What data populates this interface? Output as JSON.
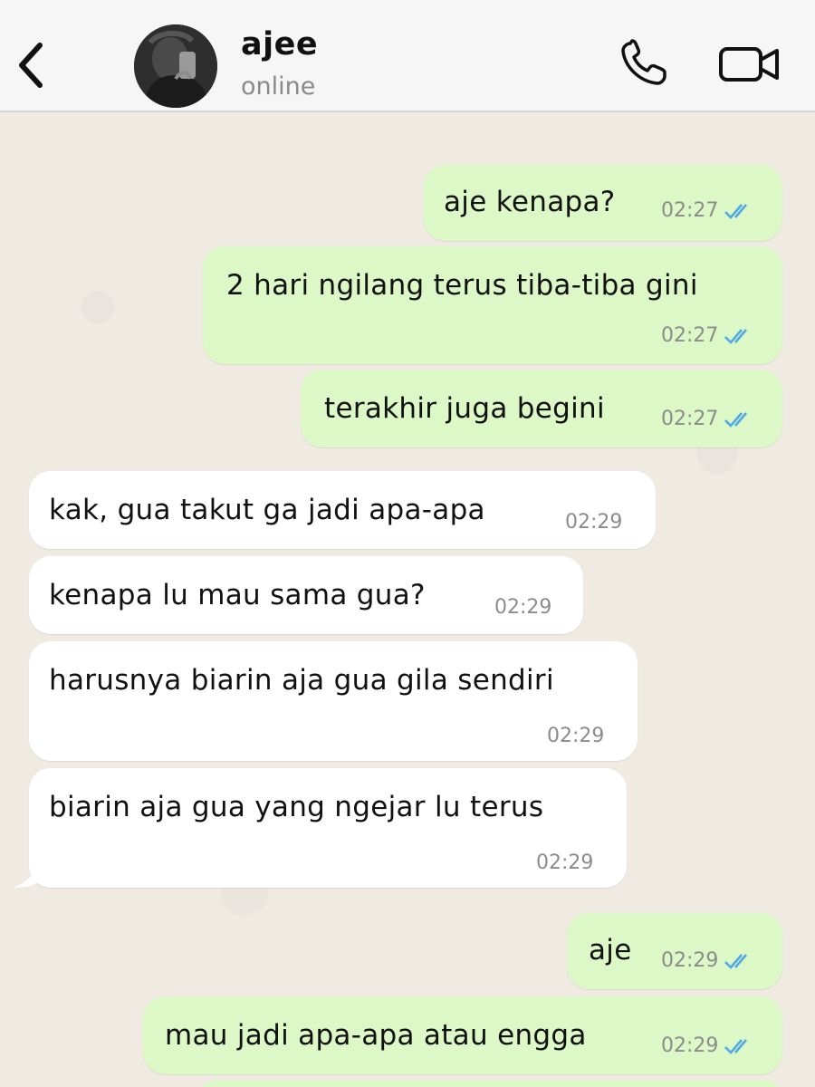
{
  "header": {
    "contact_name": "ajee",
    "status": "online",
    "back_icon": "chevron-left-icon",
    "call_icon": "phone-icon",
    "video_icon": "video-camera-icon"
  },
  "colors": {
    "outgoing_bubble": "#dcf8c6",
    "incoming_bubble": "#ffffff",
    "read_ticks": "#4fa8e8",
    "chat_background": "#efeae2"
  },
  "messages": [
    {
      "direction": "outgoing",
      "text": "aje kenapa?",
      "time": "02:27",
      "status": "read"
    },
    {
      "direction": "outgoing",
      "text": "2 hari ngilang terus tiba-tiba gini",
      "time": "02:27",
      "status": "read"
    },
    {
      "direction": "outgoing",
      "text": "terakhir juga begini",
      "time": "02:27",
      "status": "read"
    },
    {
      "direction": "incoming",
      "text": "kak, gua takut ga jadi apa-apa",
      "time": "02:29"
    },
    {
      "direction": "incoming",
      "text": "kenapa lu mau sama gua?",
      "time": "02:29"
    },
    {
      "direction": "incoming",
      "text": "harusnya biarin aja gua gila sendiri",
      "time": "02:29"
    },
    {
      "direction": "incoming",
      "text": "biarin aja gua yang ngejar lu terus",
      "time": "02:29"
    },
    {
      "direction": "outgoing",
      "text": "aje",
      "time": "02:29",
      "status": "read"
    },
    {
      "direction": "outgoing",
      "text": "mau jadi apa-apa atau engga",
      "time": "02:29",
      "status": "read"
    }
  ]
}
